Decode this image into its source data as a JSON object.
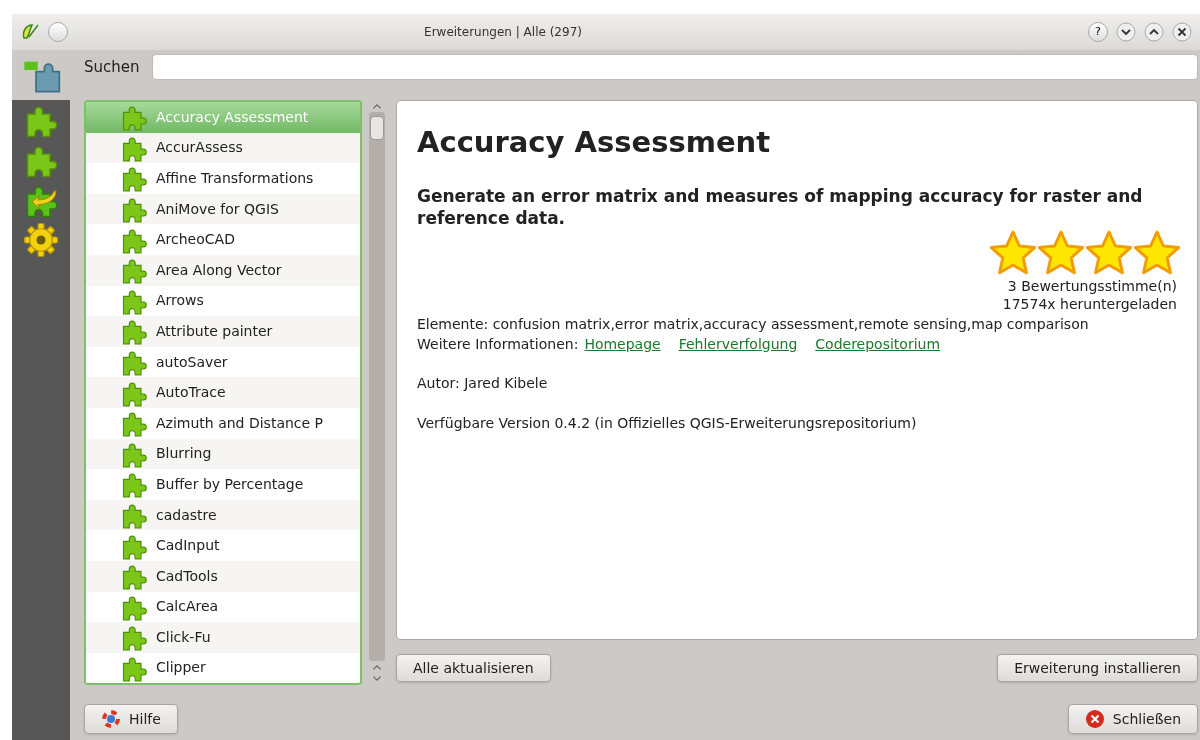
{
  "window": {
    "title": "Erweiterungen | Alle (297)"
  },
  "sidebar": {
    "items": [
      {
        "selected": true
      },
      {
        "selected": false
      },
      {
        "selected": false
      },
      {
        "selected": false
      },
      {
        "selected": false
      }
    ]
  },
  "search": {
    "label": "Suchen"
  },
  "plugins": [
    {
      "name": "Accuracy Assessment",
      "selected": true
    },
    {
      "name": "AccurAssess",
      "selected": false
    },
    {
      "name": "Affine Transformations",
      "selected": false
    },
    {
      "name": "AniMove for QGIS",
      "selected": false
    },
    {
      "name": "ArcheoCAD",
      "selected": false
    },
    {
      "name": "Area Along Vector",
      "selected": false
    },
    {
      "name": "Arrows",
      "selected": false
    },
    {
      "name": "Attribute painter",
      "selected": false
    },
    {
      "name": "autoSaver",
      "selected": false
    },
    {
      "name": "AutoTrace",
      "selected": false
    },
    {
      "name": "Azimuth and Distance P",
      "selected": false
    },
    {
      "name": "Blurring",
      "selected": false
    },
    {
      "name": "Buffer by Percentage",
      "selected": false
    },
    {
      "name": "cadastre",
      "selected": false
    },
    {
      "name": "CadInput",
      "selected": false
    },
    {
      "name": "CadTools",
      "selected": false
    },
    {
      "name": "CalcArea",
      "selected": false
    },
    {
      "name": "Click-Fu",
      "selected": false
    },
    {
      "name": "Clipper",
      "selected": false
    }
  ],
  "details": {
    "title": "Accuracy Assessment",
    "description": "Generate an error matrix and measures of mapping accuracy for raster and reference data.",
    "stars": 4,
    "votes": "3 Bewertungsstimme(n)",
    "downloads": "17574x heruntergeladen",
    "tags": "Elemente: confusion matrix,error matrix,accuracy assessment,remote sensing,map comparison",
    "more_label": "Weitere Informationen:",
    "links": [
      "Homepage",
      "Fehlerverfolgung",
      "Coderepositorium"
    ],
    "author": "Autor: Jared Kibele",
    "version": "Verfügbare Version 0.4.2 (in Offizielles QGIS-Erweiterungsrepositorium)"
  },
  "buttons": {
    "upgrade_all": "Alle aktualisieren",
    "install": "Erweiterung installieren",
    "help": "Hilfe",
    "close": "Schließen"
  },
  "title_buttons": {
    "help": "?"
  }
}
